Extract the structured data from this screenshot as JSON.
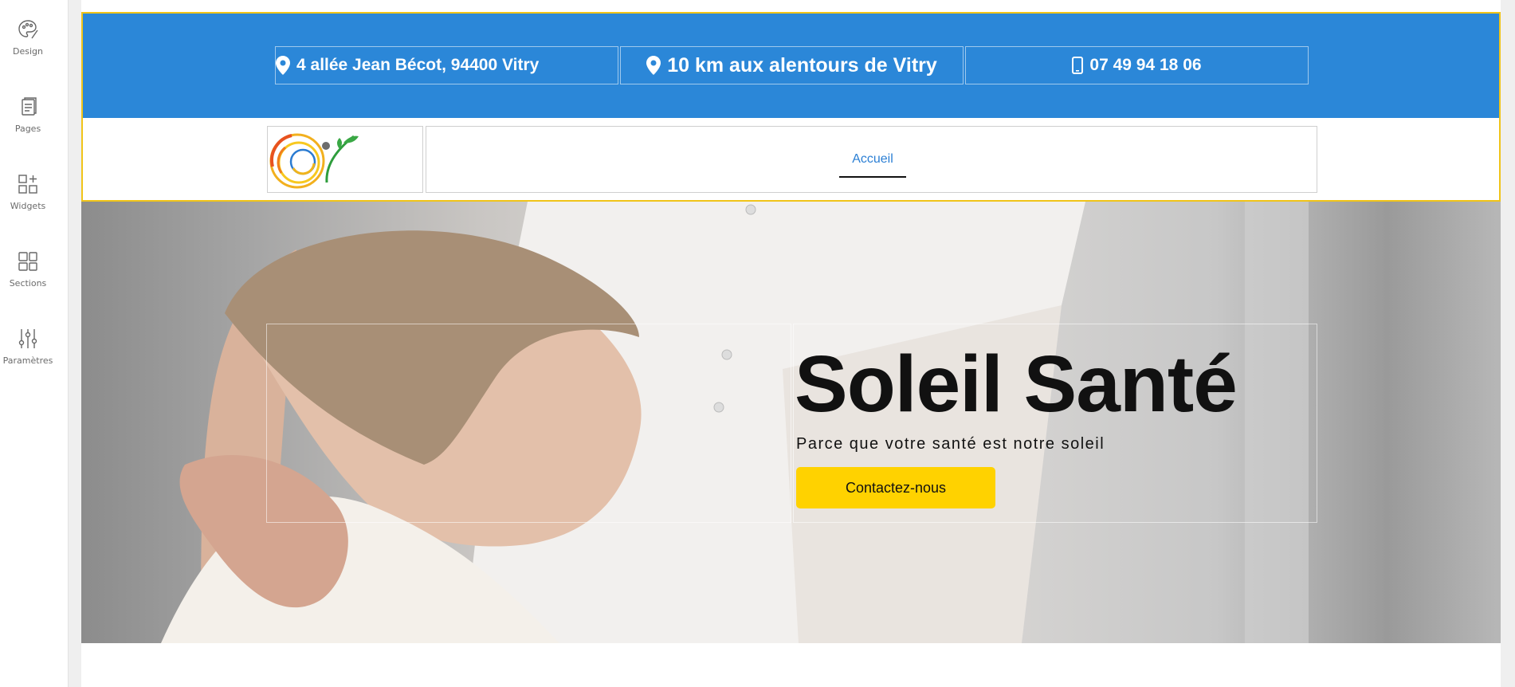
{
  "editor_sidebar": {
    "items": [
      {
        "label": "Design",
        "icon": "palette-icon"
      },
      {
        "label": "Pages",
        "icon": "pages-icon"
      },
      {
        "label": "Widgets",
        "icon": "widgets-icon"
      },
      {
        "label": "Sections",
        "icon": "sections-icon"
      },
      {
        "label": "Paramètres",
        "icon": "sliders-icon"
      }
    ]
  },
  "topbar": {
    "background_color": "#2b87d8",
    "address": "4 allée Jean Bécot, 94400 Vitry",
    "area": "10 km aux alentours de Vitry",
    "phone": "07 49 94 18 06"
  },
  "nav": {
    "items": [
      {
        "label": "Accueil"
      }
    ],
    "link_color": "#2b7fd4"
  },
  "hero": {
    "title": "Soleil Santé",
    "subtitle": "Parce que votre santé est notre soleil",
    "cta_label": "Contactez-nous",
    "cta_color": "#ffd200"
  },
  "selection_outline_color": "#f0c419"
}
